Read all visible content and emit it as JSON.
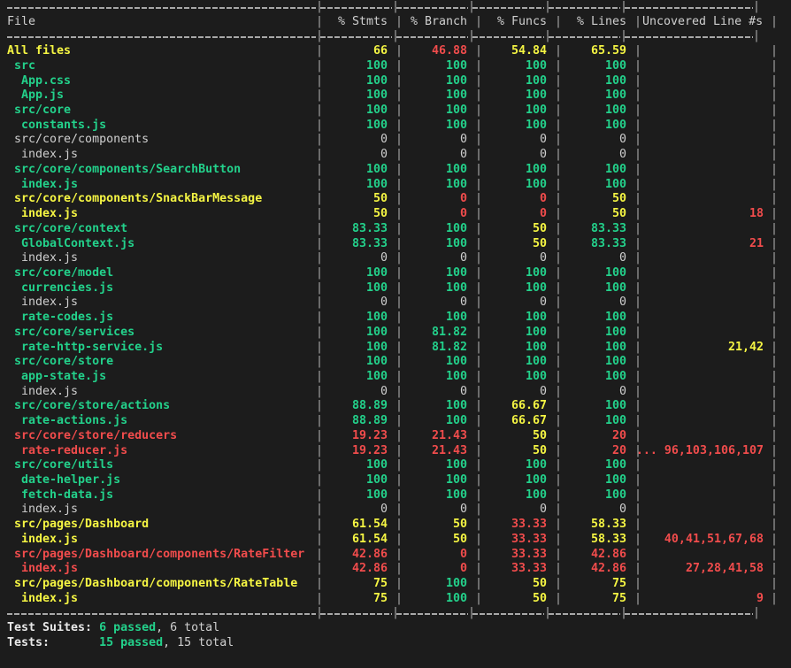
{
  "terminal": {
    "background": "#1c1c1c",
    "colors": {
      "green": "#23d18b",
      "yellow": "#f5f543",
      "red": "#f14c4c",
      "white": "#cfcfcf",
      "border": "#a8a8a8"
    }
  },
  "table": {
    "headers": {
      "file": "File",
      "stmts": "% Stmts",
      "branch": "% Branch",
      "funcs": "% Funcs",
      "lines": "% Lines",
      "uncovered": "Uncovered Line #s"
    },
    "rows": [
      {
        "file": "All files",
        "indent": 0,
        "file_color": "yellow",
        "stmts": "66",
        "stmts_color": "yellow",
        "branch": "46.88",
        "branch_color": "red",
        "funcs": "54.84",
        "funcs_color": "yellow",
        "lines": "65.59",
        "lines_color": "yellow",
        "uncovered": "",
        "uncovered_color": "red"
      },
      {
        "file": "src",
        "indent": 1,
        "file_color": "green",
        "stmts": "100",
        "stmts_color": "green",
        "branch": "100",
        "branch_color": "green",
        "funcs": "100",
        "funcs_color": "green",
        "lines": "100",
        "lines_color": "green",
        "uncovered": "",
        "uncovered_color": "red"
      },
      {
        "file": "App.css",
        "indent": 2,
        "file_color": "green",
        "stmts": "100",
        "stmts_color": "green",
        "branch": "100",
        "branch_color": "green",
        "funcs": "100",
        "funcs_color": "green",
        "lines": "100",
        "lines_color": "green",
        "uncovered": "",
        "uncovered_color": "red"
      },
      {
        "file": "App.js",
        "indent": 2,
        "file_color": "green",
        "stmts": "100",
        "stmts_color": "green",
        "branch": "100",
        "branch_color": "green",
        "funcs": "100",
        "funcs_color": "green",
        "lines": "100",
        "lines_color": "green",
        "uncovered": "",
        "uncovered_color": "red"
      },
      {
        "file": "src/core",
        "indent": 1,
        "file_color": "green",
        "stmts": "100",
        "stmts_color": "green",
        "branch": "100",
        "branch_color": "green",
        "funcs": "100",
        "funcs_color": "green",
        "lines": "100",
        "lines_color": "green",
        "uncovered": "",
        "uncovered_color": "red"
      },
      {
        "file": "constants.js",
        "indent": 2,
        "file_color": "green",
        "stmts": "100",
        "stmts_color": "green",
        "branch": "100",
        "branch_color": "green",
        "funcs": "100",
        "funcs_color": "green",
        "lines": "100",
        "lines_color": "green",
        "uncovered": "",
        "uncovered_color": "red"
      },
      {
        "file": "src/core/components",
        "indent": 1,
        "file_color": "white",
        "stmts": "0",
        "stmts_color": "white",
        "branch": "0",
        "branch_color": "white",
        "funcs": "0",
        "funcs_color": "white",
        "lines": "0",
        "lines_color": "white",
        "uncovered": "",
        "uncovered_color": "red"
      },
      {
        "file": "index.js",
        "indent": 2,
        "file_color": "white",
        "stmts": "0",
        "stmts_color": "white",
        "branch": "0",
        "branch_color": "white",
        "funcs": "0",
        "funcs_color": "white",
        "lines": "0",
        "lines_color": "white",
        "uncovered": "",
        "uncovered_color": "red"
      },
      {
        "file": "src/core/components/SearchButton",
        "indent": 1,
        "file_color": "green",
        "stmts": "100",
        "stmts_color": "green",
        "branch": "100",
        "branch_color": "green",
        "funcs": "100",
        "funcs_color": "green",
        "lines": "100",
        "lines_color": "green",
        "uncovered": "",
        "uncovered_color": "red"
      },
      {
        "file": "index.js",
        "indent": 2,
        "file_color": "green",
        "stmts": "100",
        "stmts_color": "green",
        "branch": "100",
        "branch_color": "green",
        "funcs": "100",
        "funcs_color": "green",
        "lines": "100",
        "lines_color": "green",
        "uncovered": "",
        "uncovered_color": "red"
      },
      {
        "file": "src/core/components/SnackBarMessage",
        "indent": 1,
        "file_color": "yellow",
        "stmts": "50",
        "stmts_color": "yellow",
        "branch": "0",
        "branch_color": "red",
        "funcs": "0",
        "funcs_color": "red",
        "lines": "50",
        "lines_color": "yellow",
        "uncovered": "",
        "uncovered_color": "red"
      },
      {
        "file": "index.js",
        "indent": 2,
        "file_color": "yellow",
        "stmts": "50",
        "stmts_color": "yellow",
        "branch": "0",
        "branch_color": "red",
        "funcs": "0",
        "funcs_color": "red",
        "lines": "50",
        "lines_color": "yellow",
        "uncovered": "18",
        "uncovered_color": "red"
      },
      {
        "file": "src/core/context",
        "indent": 1,
        "file_color": "green",
        "stmts": "83.33",
        "stmts_color": "green",
        "branch": "100",
        "branch_color": "green",
        "funcs": "50",
        "funcs_color": "yellow",
        "lines": "83.33",
        "lines_color": "green",
        "uncovered": "",
        "uncovered_color": "red"
      },
      {
        "file": "GlobalContext.js",
        "indent": 2,
        "file_color": "green",
        "stmts": "83.33",
        "stmts_color": "green",
        "branch": "100",
        "branch_color": "green",
        "funcs": "50",
        "funcs_color": "yellow",
        "lines": "83.33",
        "lines_color": "green",
        "uncovered": "21",
        "uncovered_color": "red"
      },
      {
        "file": "index.js",
        "indent": 2,
        "file_color": "white",
        "stmts": "0",
        "stmts_color": "white",
        "branch": "0",
        "branch_color": "white",
        "funcs": "0",
        "funcs_color": "white",
        "lines": "0",
        "lines_color": "white",
        "uncovered": "",
        "uncovered_color": "red"
      },
      {
        "file": "src/core/model",
        "indent": 1,
        "file_color": "green",
        "stmts": "100",
        "stmts_color": "green",
        "branch": "100",
        "branch_color": "green",
        "funcs": "100",
        "funcs_color": "green",
        "lines": "100",
        "lines_color": "green",
        "uncovered": "",
        "uncovered_color": "red"
      },
      {
        "file": "currencies.js",
        "indent": 2,
        "file_color": "green",
        "stmts": "100",
        "stmts_color": "green",
        "branch": "100",
        "branch_color": "green",
        "funcs": "100",
        "funcs_color": "green",
        "lines": "100",
        "lines_color": "green",
        "uncovered": "",
        "uncovered_color": "red"
      },
      {
        "file": "index.js",
        "indent": 2,
        "file_color": "white",
        "stmts": "0",
        "stmts_color": "white",
        "branch": "0",
        "branch_color": "white",
        "funcs": "0",
        "funcs_color": "white",
        "lines": "0",
        "lines_color": "white",
        "uncovered": "",
        "uncovered_color": "red"
      },
      {
        "file": "rate-codes.js",
        "indent": 2,
        "file_color": "green",
        "stmts": "100",
        "stmts_color": "green",
        "branch": "100",
        "branch_color": "green",
        "funcs": "100",
        "funcs_color": "green",
        "lines": "100",
        "lines_color": "green",
        "uncovered": "",
        "uncovered_color": "red"
      },
      {
        "file": "src/core/services",
        "indent": 1,
        "file_color": "green",
        "stmts": "100",
        "stmts_color": "green",
        "branch": "81.82",
        "branch_color": "green",
        "funcs": "100",
        "funcs_color": "green",
        "lines": "100",
        "lines_color": "green",
        "uncovered": "",
        "uncovered_color": "red"
      },
      {
        "file": "rate-http-service.js",
        "indent": 2,
        "file_color": "green",
        "stmts": "100",
        "stmts_color": "green",
        "branch": "81.82",
        "branch_color": "green",
        "funcs": "100",
        "funcs_color": "green",
        "lines": "100",
        "lines_color": "green",
        "uncovered": "21,42",
        "uncovered_color": "yellow"
      },
      {
        "file": "src/core/store",
        "indent": 1,
        "file_color": "green",
        "stmts": "100",
        "stmts_color": "green",
        "branch": "100",
        "branch_color": "green",
        "funcs": "100",
        "funcs_color": "green",
        "lines": "100",
        "lines_color": "green",
        "uncovered": "",
        "uncovered_color": "red"
      },
      {
        "file": "app-state.js",
        "indent": 2,
        "file_color": "green",
        "stmts": "100",
        "stmts_color": "green",
        "branch": "100",
        "branch_color": "green",
        "funcs": "100",
        "funcs_color": "green",
        "lines": "100",
        "lines_color": "green",
        "uncovered": "",
        "uncovered_color": "red"
      },
      {
        "file": "index.js",
        "indent": 2,
        "file_color": "white",
        "stmts": "0",
        "stmts_color": "white",
        "branch": "0",
        "branch_color": "white",
        "funcs": "0",
        "funcs_color": "white",
        "lines": "0",
        "lines_color": "white",
        "uncovered": "",
        "uncovered_color": "red"
      },
      {
        "file": "src/core/store/actions",
        "indent": 1,
        "file_color": "green",
        "stmts": "88.89",
        "stmts_color": "green",
        "branch": "100",
        "branch_color": "green",
        "funcs": "66.67",
        "funcs_color": "yellow",
        "lines": "100",
        "lines_color": "green",
        "uncovered": "",
        "uncovered_color": "red"
      },
      {
        "file": "rate-actions.js",
        "indent": 2,
        "file_color": "green",
        "stmts": "88.89",
        "stmts_color": "green",
        "branch": "100",
        "branch_color": "green",
        "funcs": "66.67",
        "funcs_color": "yellow",
        "lines": "100",
        "lines_color": "green",
        "uncovered": "",
        "uncovered_color": "red"
      },
      {
        "file": "src/core/store/reducers",
        "indent": 1,
        "file_color": "red",
        "stmts": "19.23",
        "stmts_color": "red",
        "branch": "21.43",
        "branch_color": "red",
        "funcs": "50",
        "funcs_color": "yellow",
        "lines": "20",
        "lines_color": "red",
        "uncovered": "",
        "uncovered_color": "red"
      },
      {
        "file": "rate-reducer.js",
        "indent": 2,
        "file_color": "red",
        "stmts": "19.23",
        "stmts_color": "red",
        "branch": "21.43",
        "branch_color": "red",
        "funcs": "50",
        "funcs_color": "yellow",
        "lines": "20",
        "lines_color": "red",
        "uncovered": "... 96,103,106,107",
        "uncovered_color": "red"
      },
      {
        "file": "src/core/utils",
        "indent": 1,
        "file_color": "green",
        "stmts": "100",
        "stmts_color": "green",
        "branch": "100",
        "branch_color": "green",
        "funcs": "100",
        "funcs_color": "green",
        "lines": "100",
        "lines_color": "green",
        "uncovered": "",
        "uncovered_color": "red"
      },
      {
        "file": "date-helper.js",
        "indent": 2,
        "file_color": "green",
        "stmts": "100",
        "stmts_color": "green",
        "branch": "100",
        "branch_color": "green",
        "funcs": "100",
        "funcs_color": "green",
        "lines": "100",
        "lines_color": "green",
        "uncovered": "",
        "uncovered_color": "red"
      },
      {
        "file": "fetch-data.js",
        "indent": 2,
        "file_color": "green",
        "stmts": "100",
        "stmts_color": "green",
        "branch": "100",
        "branch_color": "green",
        "funcs": "100",
        "funcs_color": "green",
        "lines": "100",
        "lines_color": "green",
        "uncovered": "",
        "uncovered_color": "red"
      },
      {
        "file": "index.js",
        "indent": 2,
        "file_color": "white",
        "stmts": "0",
        "stmts_color": "white",
        "branch": "0",
        "branch_color": "white",
        "funcs": "0",
        "funcs_color": "white",
        "lines": "0",
        "lines_color": "white",
        "uncovered": "",
        "uncovered_color": "red"
      },
      {
        "file": "src/pages/Dashboard",
        "indent": 1,
        "file_color": "yellow",
        "stmts": "61.54",
        "stmts_color": "yellow",
        "branch": "50",
        "branch_color": "yellow",
        "funcs": "33.33",
        "funcs_color": "red",
        "lines": "58.33",
        "lines_color": "yellow",
        "uncovered": "",
        "uncovered_color": "red"
      },
      {
        "file": "index.js",
        "indent": 2,
        "file_color": "yellow",
        "stmts": "61.54",
        "stmts_color": "yellow",
        "branch": "50",
        "branch_color": "yellow",
        "funcs": "33.33",
        "funcs_color": "red",
        "lines": "58.33",
        "lines_color": "yellow",
        "uncovered": "40,41,51,67,68",
        "uncovered_color": "red"
      },
      {
        "file": "src/pages/Dashboard/components/RateFilter",
        "indent": 1,
        "file_color": "red",
        "stmts": "42.86",
        "stmts_color": "red",
        "branch": "0",
        "branch_color": "red",
        "funcs": "33.33",
        "funcs_color": "red",
        "lines": "42.86",
        "lines_color": "red",
        "uncovered": "",
        "uncovered_color": "red"
      },
      {
        "file": "index.js",
        "indent": 2,
        "file_color": "red",
        "stmts": "42.86",
        "stmts_color": "red",
        "branch": "0",
        "branch_color": "red",
        "funcs": "33.33",
        "funcs_color": "red",
        "lines": "42.86",
        "lines_color": "red",
        "uncovered": "27,28,41,58",
        "uncovered_color": "red"
      },
      {
        "file": "src/pages/Dashboard/components/RateTable",
        "indent": 1,
        "file_color": "yellow",
        "stmts": "75",
        "stmts_color": "yellow",
        "branch": "100",
        "branch_color": "green",
        "funcs": "50",
        "funcs_color": "yellow",
        "lines": "75",
        "lines_color": "yellow",
        "uncovered": "",
        "uncovered_color": "red"
      },
      {
        "file": "index.js",
        "indent": 2,
        "file_color": "yellow",
        "stmts": "75",
        "stmts_color": "yellow",
        "branch": "100",
        "branch_color": "green",
        "funcs": "50",
        "funcs_color": "yellow",
        "lines": "75",
        "lines_color": "yellow",
        "uncovered": "9",
        "uncovered_color": "red"
      }
    ]
  },
  "summary": {
    "suites": {
      "label": "Test Suites:",
      "passed": "6 passed",
      "separator": ", ",
      "total": "6 total"
    },
    "tests": {
      "label": "Tests:",
      "passed": "15 passed",
      "separator": ", ",
      "total": "15 total"
    }
  }
}
